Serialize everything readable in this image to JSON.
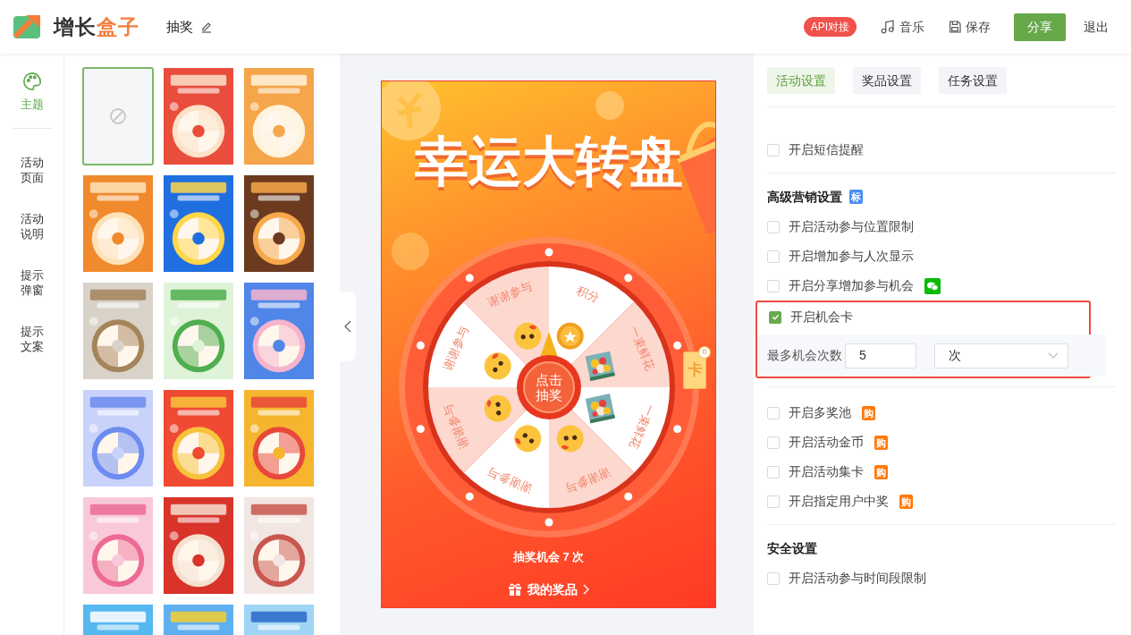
{
  "header": {
    "logo_dark": "增长",
    "logo_accent": "盒子",
    "title": "抽奖",
    "api_badge": "API对接",
    "actions": [
      {
        "kind": "music",
        "label": "音乐"
      },
      {
        "kind": "save",
        "label": "保存"
      }
    ],
    "share": "分享",
    "exit": "退出"
  },
  "sidebar": {
    "items": [
      {
        "kind": "palette",
        "label": "主题",
        "selected": true
      },
      {
        "kind": "text",
        "label": "活动页面",
        "selected": false
      },
      {
        "kind": "text",
        "label": "活动说明",
        "selected": false
      },
      {
        "kind": "text",
        "label": "提示弹窗",
        "selected": false
      },
      {
        "kind": "text",
        "label": "提示文案",
        "selected": false
      }
    ]
  },
  "templates": [
    {
      "kind": "none",
      "selected": true
    },
    {
      "kind": "picture",
      "selected": false
    },
    {
      "kind": "picture",
      "selected": false
    },
    {
      "kind": "picture",
      "selected": false
    },
    {
      "kind": "picture",
      "selected": false
    },
    {
      "kind": "picture",
      "selected": false
    },
    {
      "kind": "picture",
      "selected": false
    },
    {
      "kind": "picture",
      "selected": false
    },
    {
      "kind": "picture",
      "selected": false
    },
    {
      "kind": "picture",
      "selected": false
    },
    {
      "kind": "picture",
      "selected": false
    },
    {
      "kind": "picture",
      "selected": false
    },
    {
      "kind": "picture",
      "selected": false
    },
    {
      "kind": "picture",
      "selected": false
    },
    {
      "kind": "picture",
      "selected": false
    },
    {
      "kind": "picture",
      "selected": false
    },
    {
      "kind": "picture",
      "selected": false
    },
    {
      "kind": "picture",
      "selected": false
    }
  ],
  "preview": {
    "title": "幸运大转盘",
    "segments": [
      {
        "label": "谢谢参与",
        "kind": "smiley"
      },
      {
        "label": "积分",
        "kind": "coin"
      },
      {
        "label": "一束鲜花",
        "kind": "flowers"
      },
      {
        "label": "一束鲜花",
        "kind": "flowers"
      },
      {
        "label": "谢谢参与",
        "kind": "smiley"
      },
      {
        "label": "谢谢参与",
        "kind": "smiley"
      },
      {
        "label": "谢谢参与",
        "kind": "smiley"
      },
      {
        "label": "谢谢参与",
        "kind": "smiley"
      }
    ],
    "spin_button": "点击抽奖",
    "card": {
      "label": "卡",
      "count": "0"
    },
    "chances": "抽奖机会 7 次",
    "my_prizes": "我的奖品"
  },
  "settings": {
    "tabs": [
      {
        "label": "活动设置",
        "selected": true
      },
      {
        "label": "奖品设置",
        "selected": false
      },
      {
        "label": "任务设置",
        "selected": false
      }
    ],
    "sections": [
      {
        "items": [
          {
            "label": "开启短信提醒",
            "checked": false
          }
        ]
      },
      {
        "title": "高级营销设置",
        "badge": "标",
        "items": [
          {
            "label": "开启活动参与位置限制",
            "checked": false
          },
          {
            "label": "开启增加参与人次显示",
            "checked": false
          },
          {
            "label": "开启分享增加参与机会",
            "checked": false,
            "tag": {
              "kind": "wechat"
            }
          },
          {
            "label": "开启机会卡",
            "checked": true,
            "highlighted": true,
            "field": {
              "label": "最多机会次数",
              "value": "5",
              "unit": "次"
            }
          }
        ]
      },
      {
        "items": [
          {
            "label": "开启多奖池",
            "checked": false,
            "tag": {
              "kind": "buy",
              "label": "购"
            }
          },
          {
            "label": "开启活动金币",
            "checked": false,
            "tag": {
              "kind": "buy",
              "label": "购"
            }
          },
          {
            "label": "开启活动集卡",
            "checked": false,
            "tag": {
              "kind": "buy",
              "label": "购"
            }
          },
          {
            "label": "开启指定用户中奖",
            "checked": false,
            "tag": {
              "kind": "buy",
              "label": "购"
            }
          }
        ]
      },
      {
        "title": "安全设置",
        "items": [
          {
            "label": "开启活动参与时间段限制",
            "checked": false
          }
        ]
      }
    ]
  }
}
